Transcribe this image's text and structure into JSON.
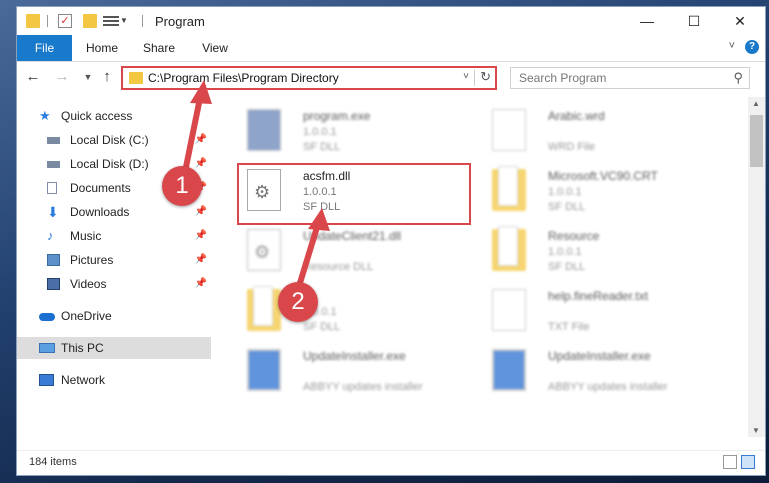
{
  "window": {
    "title": "Program"
  },
  "ribbon": {
    "tabs": [
      {
        "label": "File"
      },
      {
        "label": "Home"
      },
      {
        "label": "Share"
      },
      {
        "label": "View"
      }
    ]
  },
  "address": {
    "path": "C:\\Program Files\\Program Directory"
  },
  "search": {
    "placeholder": "Search Program"
  },
  "sidebar": {
    "items": [
      {
        "label": "Quick access",
        "icon": "star-icon"
      },
      {
        "label": "Local Disk (C:)",
        "icon": "drive-icon"
      },
      {
        "label": "Local Disk (D:)",
        "icon": "drive-icon"
      },
      {
        "label": "Documents",
        "icon": "document-icon"
      },
      {
        "label": "Downloads",
        "icon": "download-icon"
      },
      {
        "label": "Music",
        "icon": "music-icon"
      },
      {
        "label": "Pictures",
        "icon": "picture-icon"
      },
      {
        "label": "Videos",
        "icon": "video-icon"
      },
      {
        "label": "OneDrive",
        "icon": "cloud-icon"
      },
      {
        "label": "This PC",
        "icon": "computer-icon"
      },
      {
        "label": "Network",
        "icon": "network-icon"
      }
    ]
  },
  "files": [
    {
      "name": "program.exe",
      "version": "1.0.0.1",
      "type": "SF DLL"
    },
    {
      "name": "Arabic.wrd",
      "version": "",
      "type": "WRD File"
    },
    {
      "name": "acsfm.dll",
      "version": "1.0.0.1",
      "type": "SF DLL"
    },
    {
      "name": "Microsoft.VC90.CRT",
      "version": "1.0.0.1",
      "type": "SF DLL"
    },
    {
      "name": "UpdateClient21.dll",
      "version": "",
      "type": "Resource DLL"
    },
    {
      "name": "Resource",
      "version": "1.0.0.1",
      "type": "SF DLL"
    },
    {
      "name": "",
      "version": "1.0.0.1",
      "type": "SF DLL"
    },
    {
      "name": "help.fineReader.txt",
      "version": "",
      "type": "TXT File"
    },
    {
      "name": "UpdateInstaller.exe",
      "version": "",
      "type": "ABBYY updates installer"
    },
    {
      "name": "UpdateInstaller.exe",
      "version": "",
      "type": "ABBYY updates installer"
    }
  ],
  "status": {
    "item_count": "184 items"
  },
  "annotations": {
    "step1": "1",
    "step2": "2"
  },
  "colors": {
    "accent": "#1979ca",
    "highlight": "#d9474b"
  }
}
